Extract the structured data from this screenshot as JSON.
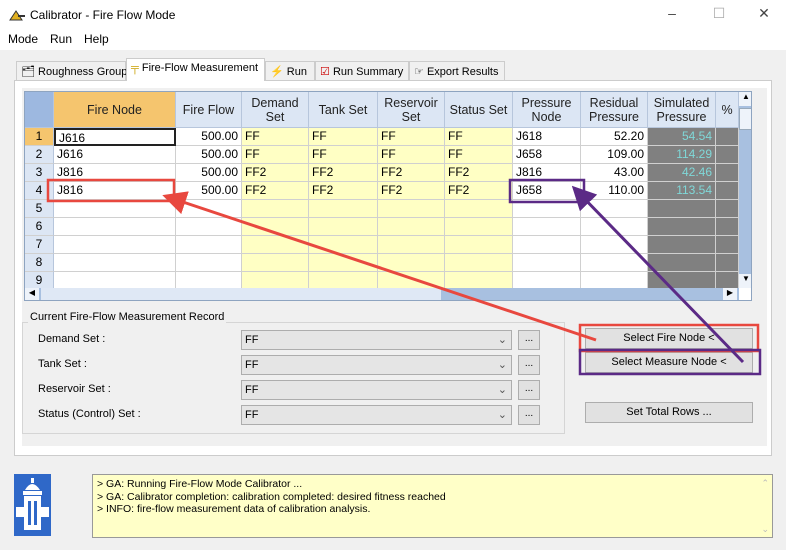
{
  "window": {
    "title": "Calibrator - Fire Flow Mode",
    "minimize": "–",
    "maximize": "☐",
    "close": "✕"
  },
  "menu": [
    "Mode",
    "Run",
    "Help"
  ],
  "tabs": [
    {
      "label": "Roughness Group",
      "icon": "roughness-group-icon"
    },
    {
      "label": "Fire-Flow Measurement",
      "icon": "hydrant-icon",
      "active": true
    },
    {
      "label": "Run",
      "icon": "lightning-icon"
    },
    {
      "label": "Run Summary",
      "icon": "report-icon"
    },
    {
      "label": "Export Results",
      "icon": "export-hand-icon"
    }
  ],
  "grid": {
    "headers": [
      "Fire Node",
      "Fire Flow",
      "Demand Set",
      "Tank Set",
      "Reservoir Set",
      "Status Set",
      "Pressure Node",
      "Residual Pressure",
      "Simulated Pressure",
      "%"
    ],
    "rows": [
      {
        "n": "1",
        "fire_node": "J616",
        "fire_flow": "500.00",
        "demand": "FF",
        "tank": "FF",
        "reservoir": "FF",
        "status": "FF",
        "pressure_node": "J618",
        "residual": "52.20",
        "simulated": "54.54"
      },
      {
        "n": "2",
        "fire_node": "J616",
        "fire_flow": "500.00",
        "demand": "FF",
        "tank": "FF",
        "reservoir": "FF",
        "status": "FF",
        "pressure_node": "J658",
        "residual": "109.00",
        "simulated": "114.29"
      },
      {
        "n": "3",
        "fire_node": "J816",
        "fire_flow": "500.00",
        "demand": "FF2",
        "tank": "FF2",
        "reservoir": "FF2",
        "status": "FF2",
        "pressure_node": "J816",
        "residual": "43.00",
        "simulated": "42.46"
      },
      {
        "n": "4",
        "fire_node": "J816",
        "fire_flow": "500.00",
        "demand": "FF2",
        "tank": "FF2",
        "reservoir": "FF2",
        "status": "FF2",
        "pressure_node": "J658",
        "residual": "110.00",
        "simulated": "113.54"
      },
      {
        "n": "5"
      },
      {
        "n": "6"
      },
      {
        "n": "7"
      },
      {
        "n": "8"
      },
      {
        "n": "9"
      }
    ]
  },
  "record": {
    "title": "Current Fire-Flow Measurement Record",
    "fields": [
      {
        "label": "Demand Set :",
        "value": "FF"
      },
      {
        "label": "Tank Set :",
        "value": "FF"
      },
      {
        "label": "Reservoir Set :",
        "value": "FF"
      },
      {
        "label": "Status (Control) Set :",
        "value": "FF"
      }
    ],
    "ellipsis": "..."
  },
  "buttons": {
    "select_fire": "Select Fire Node <",
    "select_measure": "Select Measure Node <",
    "set_rows": "Set Total Rows ..."
  },
  "log": [
    "> GA: Running Fire-Flow Mode Calibrator ...",
    "> GA: Calibrator completion: calibration completed: desired fitness reached",
    "> INFO: fire-flow measurement data of calibration analysis."
  ],
  "annotation_colors": {
    "fire": "#e8483f",
    "measure": "#5b2a86"
  }
}
